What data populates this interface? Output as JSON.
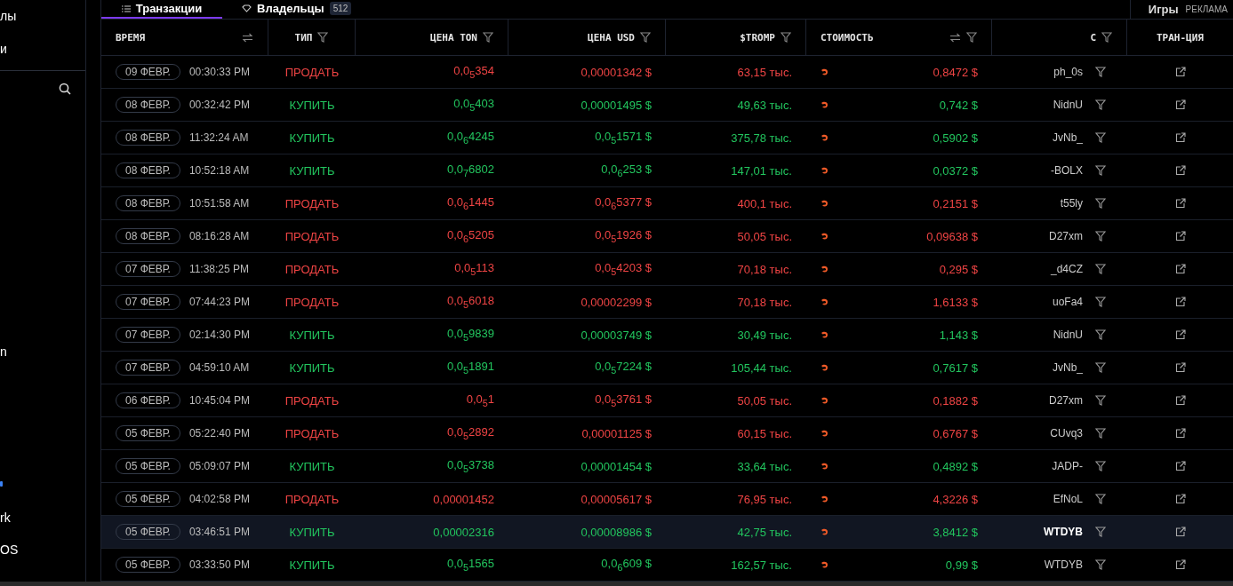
{
  "sidebar": {
    "items": [
      {
        "label": "лы"
      },
      {
        "label": "и"
      }
    ],
    "lower_items": [
      {
        "label": "n",
        "kind": "text"
      },
      {
        "kind": "icon"
      },
      {
        "label": "rk",
        "kind": "text"
      },
      {
        "label": "OS",
        "kind": "text"
      }
    ]
  },
  "tabs": [
    {
      "label": "Транзакции",
      "selected": true,
      "kind": "list"
    },
    {
      "label": "Владельцы",
      "selected": false,
      "kind": "holders",
      "count": "512"
    }
  ],
  "right_tabs": [
    {
      "label": "Игры"
    },
    {
      "label": "РЕКЛАМА"
    }
  ],
  "table": {
    "columns": [
      {
        "label": "ВРЕМЯ",
        "sort": true,
        "filter": false
      },
      {
        "label": "ТИП",
        "sort": false,
        "filter": true
      },
      {
        "label": "ЦЕНА TON",
        "sort": false,
        "filter": true
      },
      {
        "label": "ЦЕНА USD",
        "sort": false,
        "filter": true
      },
      {
        "label": "$TROMP",
        "sort": false,
        "filter": true
      },
      {
        "label": "СТОИМОСТЬ",
        "sort": true,
        "filter": true
      },
      {
        "label": "С",
        "sort": false,
        "filter": true
      },
      {
        "label": "ТРАН-ЦИЯ",
        "sort": false,
        "filter": false
      }
    ],
    "rows": [
      {
        "date": "09 ФЕВР.",
        "time": "00:30:33 PM",
        "type": "ПРОДАТЬ",
        "kind": "sell",
        "ton": "0,0$_{5}$354",
        "usd": "0,00001342 $",
        "amount": "63,15 тыс.",
        "value": "0,8472 $",
        "from": "ph_0s",
        "selected": false
      },
      {
        "date": "08 ФЕВР.",
        "time": "00:32:42 PM",
        "type": "КУПИТЬ",
        "kind": "buy",
        "ton": "0,0$_{5}$403",
        "usd": "0,00001495 $",
        "amount": "49,63 тыс.",
        "value": "0,742 $",
        "from": "NidnU",
        "selected": false
      },
      {
        "date": "08 ФЕВР.",
        "time": "11:32:24 AM",
        "type": "КУПИТЬ",
        "kind": "buy",
        "ton": "0,0$_{6}$4245",
        "usd": "0,0$_{5}$1571 $",
        "amount": "375,78 тыс.",
        "value": "0,5902 $",
        "from": "JvNb_",
        "selected": false
      },
      {
        "date": "08 ФЕВР.",
        "time": "10:52:18 AM",
        "type": "КУПИТЬ",
        "kind": "buy",
        "ton": "0,0$_{7}$6802",
        "usd": "0,0$_{6}$253 $",
        "amount": "147,01 тыс.",
        "value": "0,0372 $",
        "from": "-BOLX",
        "selected": false
      },
      {
        "date": "08 ФЕВР.",
        "time": "10:51:58 AM",
        "type": "ПРОДАТЬ",
        "kind": "sell",
        "ton": "0,0$_{6}$1445",
        "usd": "0,0$_{6}$5377 $",
        "amount": "400,1 тыс.",
        "value": "0,2151 $",
        "from": "t55ly",
        "selected": false
      },
      {
        "date": "08 ФЕВР.",
        "time": "08:16:28 AM",
        "type": "ПРОДАТЬ",
        "kind": "sell",
        "ton": "0,0$_{6}$5205",
        "usd": "0,0$_{5}$1926 $",
        "amount": "50,05 тыс.",
        "value": "0,09638 $",
        "from": "D27xm",
        "selected": false
      },
      {
        "date": "07 ФЕВР.",
        "time": "11:38:25 PM",
        "type": "ПРОДАТЬ",
        "kind": "sell",
        "ton": "0,0$_{5}$113",
        "usd": "0,0$_{5}$4203 $",
        "amount": "70,18 тыс.",
        "value": "0,295 $",
        "from": "_d4CZ",
        "selected": false
      },
      {
        "date": "07 ФЕВР.",
        "time": "07:44:23 PM",
        "type": "ПРОДАТЬ",
        "kind": "sell",
        "ton": "0,0$_{5}$6018",
        "usd": "0,00002299 $",
        "amount": "70,18 тыс.",
        "value": "1,6133 $",
        "from": "uoFa4",
        "selected": false
      },
      {
        "date": "07 ФЕВР.",
        "time": "02:14:30 PM",
        "type": "КУПИТЬ",
        "kind": "buy",
        "ton": "0,0$_{5}$9839",
        "usd": "0,00003749 $",
        "amount": "30,49 тыс.",
        "value": "1,143 $",
        "from": "NidnU",
        "selected": false
      },
      {
        "date": "07 ФЕВР.",
        "time": "04:59:10 AM",
        "type": "КУПИТЬ",
        "kind": "buy",
        "ton": "0,0$_{5}$1891",
        "usd": "0,0$_{5}$7224 $",
        "amount": "105,44 тыс.",
        "value": "0,7617 $",
        "from": "JvNb_",
        "selected": false
      },
      {
        "date": "06 ФЕВР.",
        "time": "10:45:04 PM",
        "type": "ПРОДАТЬ",
        "kind": "sell",
        "ton": "0,0$_{5}$1",
        "usd": "0,0$_{5}$3761 $",
        "amount": "50,05 тыс.",
        "value": "0,1882 $",
        "from": "D27xm",
        "selected": false
      },
      {
        "date": "05 ФЕВР.",
        "time": "05:22:40 PM",
        "type": "ПРОДАТЬ",
        "kind": "sell",
        "ton": "0,0$_{5}$2892",
        "usd": "0,00001125 $",
        "amount": "60,15 тыс.",
        "value": "0,6767 $",
        "from": "CUvq3",
        "selected": false
      },
      {
        "date": "05 ФЕВР.",
        "time": "05:09:07 PM",
        "type": "КУПИТЬ",
        "kind": "buy",
        "ton": "0,0$_{5}$3738",
        "usd": "0,00001454 $",
        "amount": "33,64 тыс.",
        "value": "0,4892 $",
        "from": "JADP-",
        "selected": false
      },
      {
        "date": "05 ФЕВР.",
        "time": "04:02:58 PM",
        "type": "ПРОДАТЬ",
        "kind": "sell",
        "ton": "0,00001452",
        "usd": "0,00005617 $",
        "amount": "76,95 тыс.",
        "value": "4,3226 $",
        "from": "EfNoL",
        "selected": false
      },
      {
        "date": "05 ФЕВР.",
        "time": "03:46:51 PM",
        "type": "КУПИТЬ",
        "kind": "buy",
        "ton": "0,00002316",
        "usd": "0,00008986 $",
        "amount": "42,75 тыс.",
        "value": "3,8412 $",
        "from": "WTDYB",
        "selected": true
      },
      {
        "date": "05 ФЕВР.",
        "time": "03:33:50 PM",
        "type": "КУПИТЬ",
        "kind": "buy",
        "ton": "0,0$_{5}$1565",
        "usd": "0,0$_{6}$609 $",
        "amount": "162,57 тыс.",
        "value": "0,99 $",
        "from": "WTDYB",
        "selected": false
      }
    ]
  }
}
